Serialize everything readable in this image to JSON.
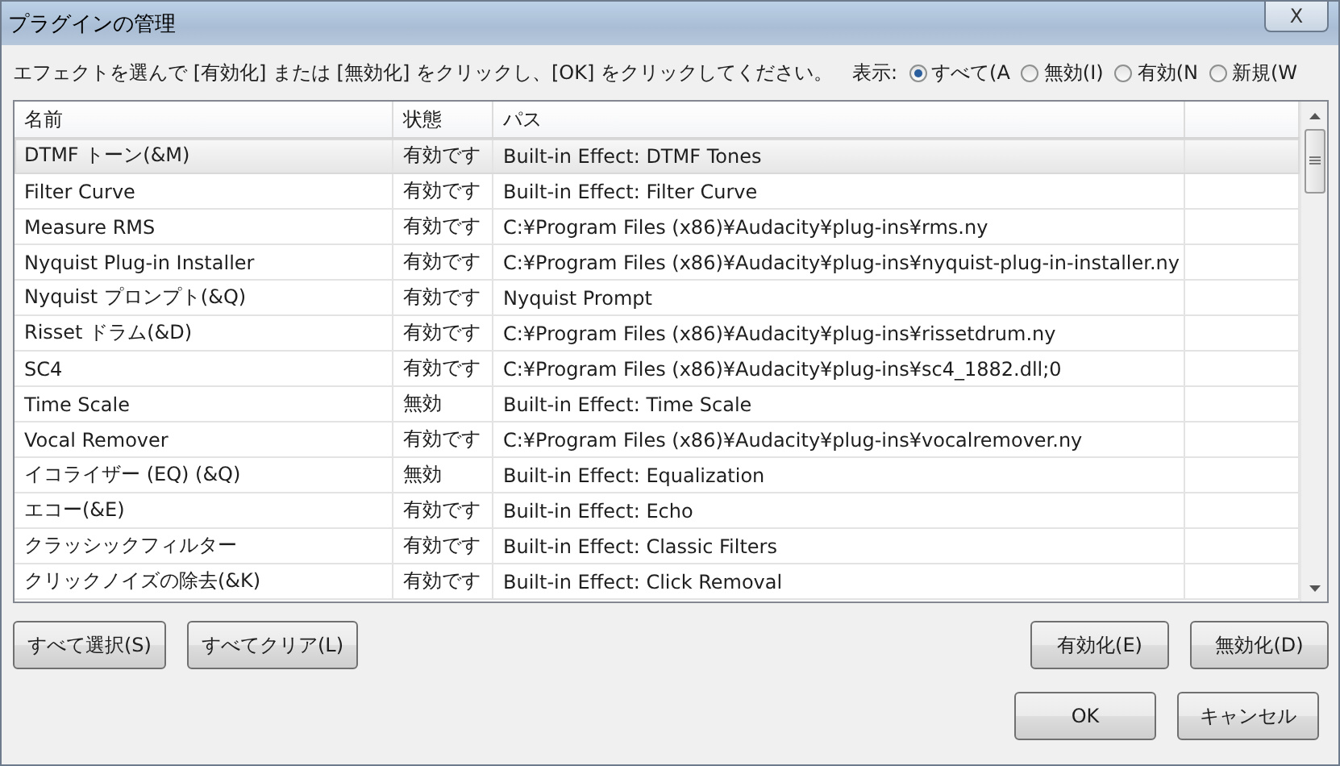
{
  "window": {
    "title": "プラグインの管理",
    "close": "X"
  },
  "instruction": "エフェクトを選んで [有効化] または [無効化] をクリックし、[OK] をクリックしてください。",
  "display_label": "表示:",
  "display_filters": [
    {
      "label": "すべて(A",
      "selected": true
    },
    {
      "label": "無効(I)",
      "selected": false
    },
    {
      "label": "有効(N",
      "selected": false
    },
    {
      "label": "新規(W",
      "selected": false
    }
  ],
  "table": {
    "columns": [
      "名前",
      "状態",
      "パス"
    ],
    "rows": [
      {
        "name": "DTMF トーン(&M)",
        "state": "有効です",
        "path": "Built-in Effect: DTMF Tones",
        "selected": true
      },
      {
        "name": "Filter Curve",
        "state": "有効です",
        "path": "Built-in Effect: Filter Curve",
        "selected": false
      },
      {
        "name": "Measure RMS",
        "state": "有効です",
        "path": "C:¥Program Files (x86)¥Audacity¥plug-ins¥rms.ny",
        "selected": false
      },
      {
        "name": "Nyquist Plug-in Installer",
        "state": "有効です",
        "path": "C:¥Program Files (x86)¥Audacity¥plug-ins¥nyquist-plug-in-installer.ny",
        "selected": false
      },
      {
        "name": "Nyquist プロンプト(&Q)",
        "state": "有効です",
        "path": "Nyquist Prompt",
        "selected": false
      },
      {
        "name": "Risset ドラム(&D)",
        "state": "有効です",
        "path": "C:¥Program Files (x86)¥Audacity¥plug-ins¥rissetdrum.ny",
        "selected": false
      },
      {
        "name": "SC4",
        "state": "有効です",
        "path": "C:¥Program Files (x86)¥Audacity¥plug-ins¥sc4_1882.dll;0",
        "selected": false
      },
      {
        "name": "Time Scale",
        "state": "無効",
        "path": "Built-in Effect: Time Scale",
        "selected": false
      },
      {
        "name": "Vocal Remover",
        "state": "有効です",
        "path": "C:¥Program Files (x86)¥Audacity¥plug-ins¥vocalremover.ny",
        "selected": false
      },
      {
        "name": "イコライザー (EQ) (&Q)",
        "state": "無効",
        "path": "Built-in Effect: Equalization",
        "selected": false
      },
      {
        "name": "エコー(&E)",
        "state": "有効です",
        "path": "Built-in Effect: Echo",
        "selected": false
      },
      {
        "name": "クラッシックフィルター",
        "state": "有効です",
        "path": "Built-in Effect: Classic Filters",
        "selected": false
      },
      {
        "name": "クリックノイズの除去(&K)",
        "state": "有効です",
        "path": "Built-in Effect: Click Removal",
        "selected": false
      }
    ]
  },
  "left_buttons": [
    "すべて選択(S)",
    "すべてクリア(L)"
  ],
  "right_buttons": [
    "有効化(E)",
    "無効化(D)"
  ],
  "dialog_buttons": [
    "OK",
    "キャンセル"
  ]
}
